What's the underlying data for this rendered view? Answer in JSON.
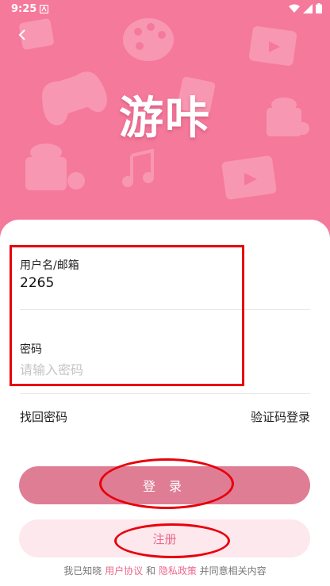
{
  "status_bar": {
    "time": "9:25",
    "icons": [
      "wifi-icon",
      "signal-icon",
      "battery-icon"
    ]
  },
  "header": {
    "back_icon": "chevron-left-icon",
    "app_title": "游咔",
    "background_color": "#f5799b",
    "decor_icons": [
      "game-controller-icon",
      "palette-icon",
      "video-icon",
      "music-note-icon",
      "gift-icon"
    ]
  },
  "form": {
    "username_label": "用户名/邮箱",
    "username_value": "2265",
    "password_label": "密码",
    "password_placeholder": "请输入密码"
  },
  "links": {
    "forgot_password": "找回密码",
    "code_login": "验证码登录"
  },
  "buttons": {
    "login": "登 录",
    "register": "注册"
  },
  "agreement": {
    "prefix": "我已知晓",
    "user_agreement": "用户协议",
    "and": "和",
    "privacy_policy": "隐私政策",
    "suffix": "并同意相关内容"
  },
  "colors": {
    "accent": "#df7d95",
    "link": "#e96b8d",
    "annotation": "#e8000b"
  }
}
